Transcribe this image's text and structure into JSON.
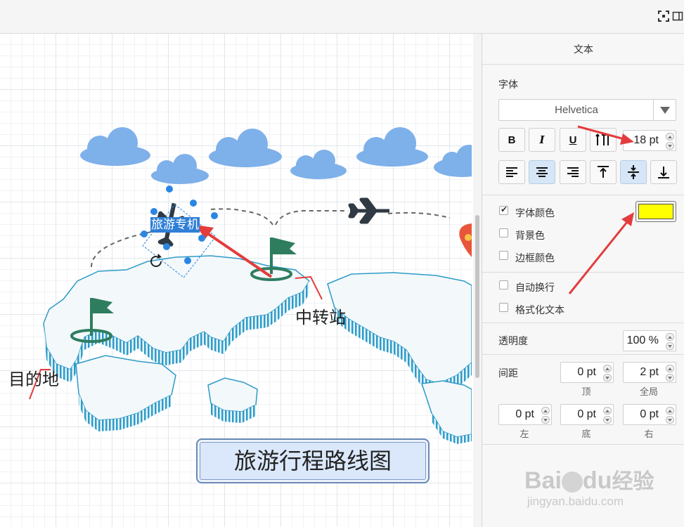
{
  "toolbar": {
    "icons": [
      "fullscreen-icon",
      "panel-toggle-icon"
    ]
  },
  "canvas": {
    "selected_label": "旅游专机",
    "label_destination": "目的地",
    "label_transfer": "中转站",
    "title_box": "旅游行程路线图",
    "colors": {
      "clouds": "#7eb0ea",
      "map": "#2e9bc7",
      "flag": "#2e7d5f",
      "arrow": "#e43c3c",
      "selection": "#2a86e4"
    }
  },
  "panel": {
    "title": "文本",
    "font": {
      "section_label": "字体",
      "family": "Helvetica",
      "bold": "B",
      "italic": "I",
      "underline": "U",
      "size": "18 pt"
    },
    "colors": {
      "font_color_label": "字体颜色",
      "font_color_checked": true,
      "font_color_value": "#ffff00",
      "background_label": "背景色",
      "background_checked": false,
      "border_label": "边框颜色",
      "border_checked": false
    },
    "options": {
      "autowrap_label": "自动换行",
      "autowrap_checked": false,
      "formatted_label": "格式化文本",
      "formatted_checked": false
    },
    "opacity": {
      "label": "透明度",
      "value": "100 %"
    },
    "spacing": {
      "label": "间距",
      "top": {
        "value": "0 pt",
        "label": "顶"
      },
      "global": {
        "value": "2 pt",
        "label": "全局"
      },
      "left": {
        "value": "0 pt",
        "label": "左"
      },
      "bottom": {
        "value": "0 pt",
        "label": "底"
      },
      "right": {
        "value": "0 pt",
        "label": "右"
      }
    }
  },
  "watermark": {
    "brand": "Bai",
    "brand_du": "du",
    "brand_cn": "经验",
    "url": "jingyan.baidu.com"
  }
}
